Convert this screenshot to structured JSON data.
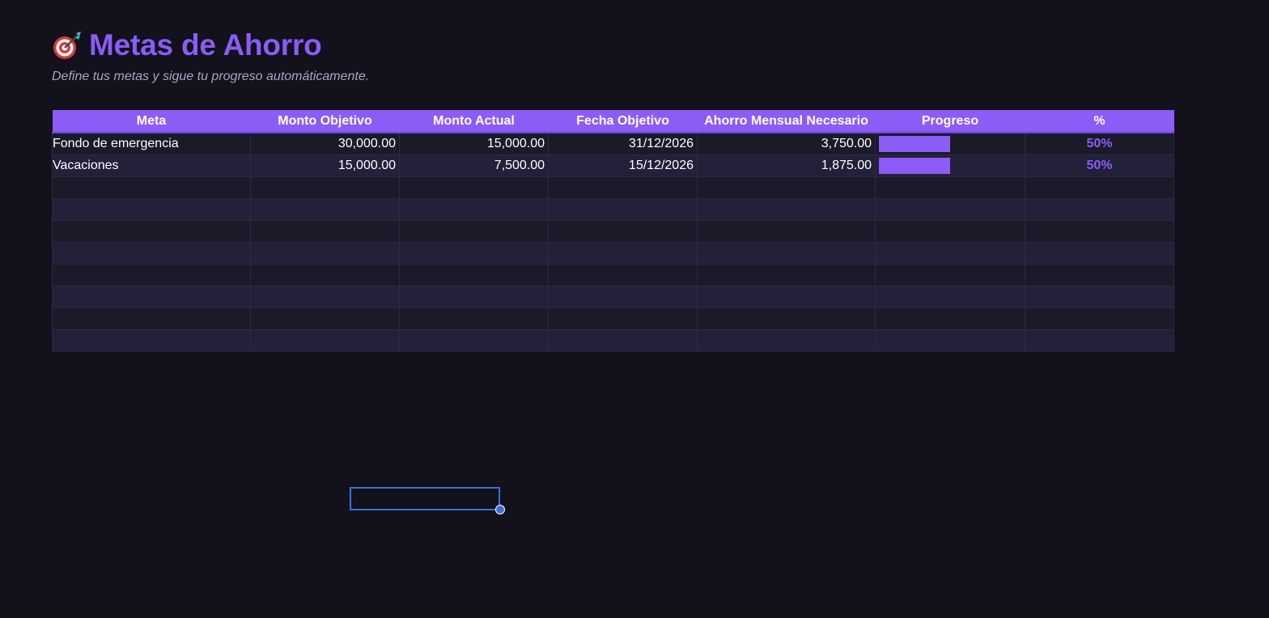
{
  "header": {
    "icon": "dart-target-icon",
    "title": "Metas de Ahorro",
    "subtitle": "Define tus metas y sigue tu progreso automáticamente."
  },
  "colors": {
    "accent": "#8b5cf6",
    "background": "#12111c",
    "row_odd": "#1b1a28",
    "row_even": "#232039",
    "selection": "#3b6fd8"
  },
  "table": {
    "columns": [
      "Meta",
      "Monto Objetivo",
      "Monto Actual",
      "Fecha Objetivo",
      "Ahorro Mensual Necesario",
      "Progreso",
      "%"
    ],
    "rows": [
      {
        "meta": "Fondo de emergencia",
        "monto_objetivo": "30,000.00",
        "monto_actual": "15,000.00",
        "fecha_objetivo": "31/12/2026",
        "ahorro_mensual": "3,750.00",
        "progreso": 0.5,
        "pct": "50%"
      },
      {
        "meta": "Vacaciones",
        "monto_objetivo": "15,000.00",
        "monto_actual": "7,500.00",
        "fecha_objetivo": "15/12/2026",
        "ahorro_mensual": "1,875.00",
        "progreso": 0.5,
        "pct": "50%"
      }
    ],
    "empty_rows": 8
  }
}
